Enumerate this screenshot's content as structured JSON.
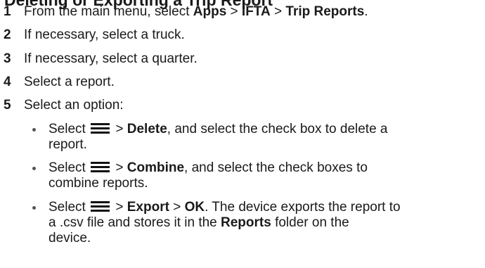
{
  "heading": "Deleting or Exporting a Trip Report",
  "steps": [
    {
      "num": "1",
      "pre": "From the main menu, select ",
      "apps": "Apps",
      "sep1": " > ",
      "ifta": "IFTA",
      "sep2": " > ",
      "trip": "Trip Reports",
      "post": "."
    },
    {
      "num": "2",
      "text": "If necessary, select a truck."
    },
    {
      "num": "3",
      "text": "If necessary, select a quarter."
    },
    {
      "num": "4",
      "text": "Select a report."
    },
    {
      "num": "5",
      "text": "Select an option:"
    }
  ],
  "options": [
    {
      "select": "Select ",
      "sep": " > ",
      "action": "Delete",
      "rest1": ", and select the check box to delete a",
      "rest2": "report."
    },
    {
      "select": "Select ",
      "sep": " > ",
      "action": "Combine",
      "rest1": ", and select the check boxes to",
      "rest2": "combine reports."
    },
    {
      "select": "Select ",
      "sep": " > ",
      "action": "Export",
      "sep2": " > ",
      "ok": "OK",
      "rest1": ". The device exports the report to",
      "rest2": "a .csv file and stores it in the ",
      "reports": "Reports",
      "rest3": " folder on the",
      "rest4": "device."
    }
  ],
  "icons": {
    "menu": "menu-icon"
  }
}
